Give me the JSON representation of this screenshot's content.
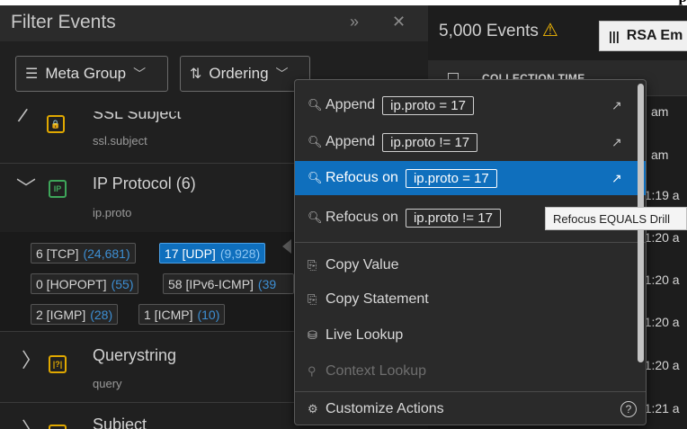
{
  "filter_panel": {
    "title": "Filter Events",
    "metagroup_label": "Meta Group",
    "ordering_label": "Ordering"
  },
  "meta_keys": [
    {
      "title": "SSL Subject",
      "sub": "ssl.subject",
      "icon": "key-icon"
    },
    {
      "title": "IP Protocol (6)",
      "sub": "ip.proto",
      "icon": "ip-icon",
      "icon_text": "IP"
    },
    {
      "title": "Querystring",
      "sub": "query",
      "icon": "querystring-icon",
      "icon_text": "|?|"
    },
    {
      "title": "Subject",
      "sub": "",
      "icon": "subject-icon"
    }
  ],
  "ip_proto_values": [
    {
      "label": "6 [TCP]",
      "count": "(24,681)",
      "selected": false
    },
    {
      "label": "17 [UDP]",
      "count": "(9,928)",
      "selected": true
    },
    {
      "label": "0 [HOPOPT]",
      "count": "(55)",
      "selected": false
    },
    {
      "label": "58 [IPv6-ICMP]",
      "count": "(39",
      "selected": false
    },
    {
      "label": "2 [IGMP]",
      "count": "(28)",
      "selected": false
    },
    {
      "label": "1 [ICMP]",
      "count": "(10)",
      "selected": false
    }
  ],
  "events": {
    "count_label": "5,000 Events",
    "rsa_button": "RSA Em",
    "column_header": "COLLECTION TIME",
    "rows": [
      "am",
      "am",
      ")1:19 a",
      ")1:20 a",
      ")1:20 a",
      ")1:20 a",
      ")1:20 a",
      ")1:21 a"
    ]
  },
  "context_menu": {
    "items": [
      {
        "label": "Append",
        "expr": "ip.proto = 17",
        "external": true
      },
      {
        "label": "Append",
        "expr": "ip.proto != 17",
        "external": true
      },
      {
        "label": "Refocus on",
        "expr": "ip.proto = 17",
        "external": true,
        "highlighted": true
      },
      {
        "label": "Refocus on",
        "expr": "ip.proto != 17",
        "external": false
      }
    ],
    "copy_value": "Copy Value",
    "copy_statement": "Copy Statement",
    "live_lookup": "Live Lookup",
    "context_lookup": "Context Lookup",
    "customize_actions": "Customize Actions"
  },
  "tooltip": "Refocus EQUALS Drill",
  "page_top_text": "p",
  "colors": {
    "highlight": "#0f6fbd",
    "warning": "#f2b705",
    "count": "#3d8fd4",
    "key_icon": "#e0a800"
  }
}
